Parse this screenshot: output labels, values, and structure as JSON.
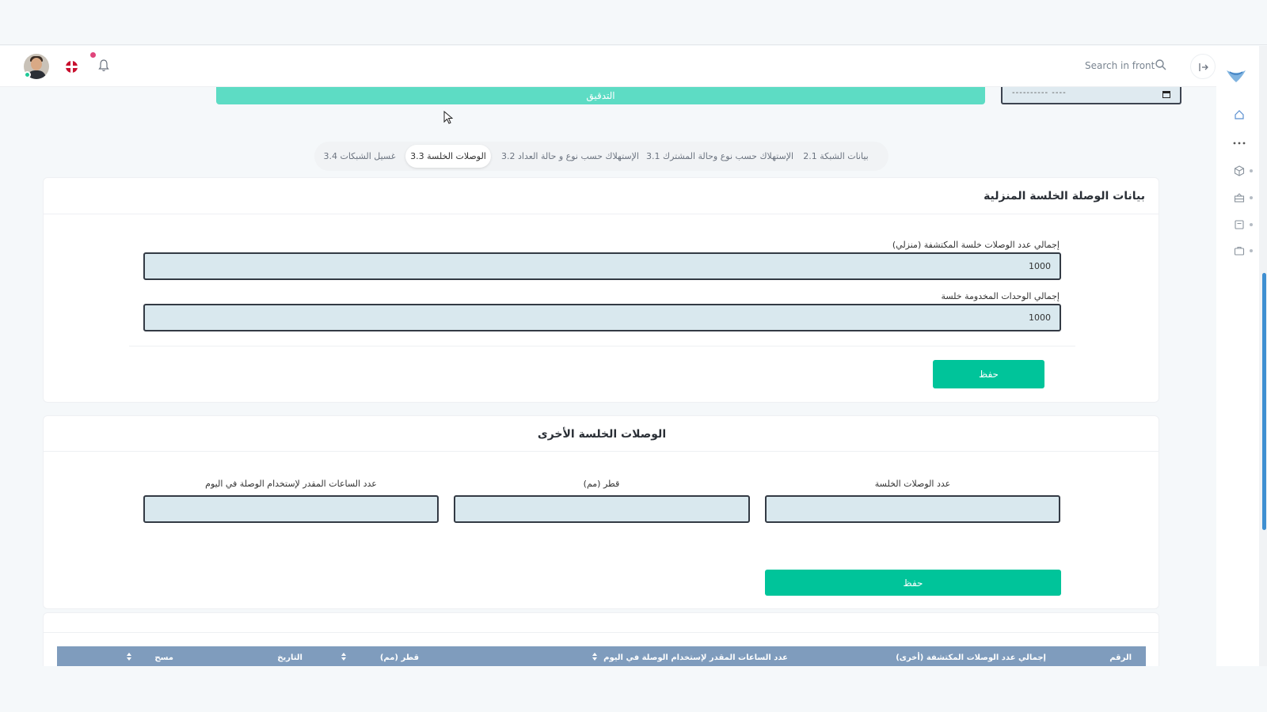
{
  "header": {
    "search_placeholder": "Search in front",
    "icons": [
      "avatar",
      "flag-uk-icon",
      "bell-icon",
      "search-icon",
      "logout-icon"
    ]
  },
  "top_controls": {
    "verify_button": "التدقيق",
    "date_placeholder": "---------- ----"
  },
  "tabs": [
    {
      "label": "2.1 بيانات الشبكة",
      "active": false
    },
    {
      "label": "3.1 الإستهلاك حسب نوع وحالة المشترك",
      "active": false
    },
    {
      "label": "3.2 الإستهلاك حسب نوع و حالة العداد",
      "active": false
    },
    {
      "label": "3.3 الوصلات الخلسة",
      "active": true
    },
    {
      "label": "3.4 غسيل الشبكات",
      "active": false
    }
  ],
  "home_section": {
    "title": "بيانات الوصلة الخلسة المنزلية",
    "field1_label": "إجمالي عدد الوصلات خلسة المكتشفة (منزلي)",
    "field1_value": "1000",
    "field2_label": "إجمالي الوحدات المخدومة خلسة",
    "field2_value": "1000",
    "save_label": "حفظ"
  },
  "other_section": {
    "title": "الوصلات الخلسة الأخرى",
    "count_label": "عدد الوصلات الخلسة",
    "diameter_label": "قطر (مم)",
    "hours_label": "عدد الساعات المقدر لإستخدام الوصلة في اليوم",
    "save_label": "حفظ"
  },
  "table": {
    "columns": [
      "الرقم",
      "إجمالي عدد الوصلات المكتشفة (أخرى)",
      "عدد الساعات المقدر لإستخدام الوصلة في اليوم",
      "قطر (مم)",
      "التاريخ",
      "مسح"
    ]
  },
  "colors": {
    "accent": "#00c49a",
    "verify": "#5ddcc4",
    "field_bg": "#d9e8ee",
    "table_header": "#7f9cbd",
    "scroll_thumb": "#3f8fd1"
  }
}
